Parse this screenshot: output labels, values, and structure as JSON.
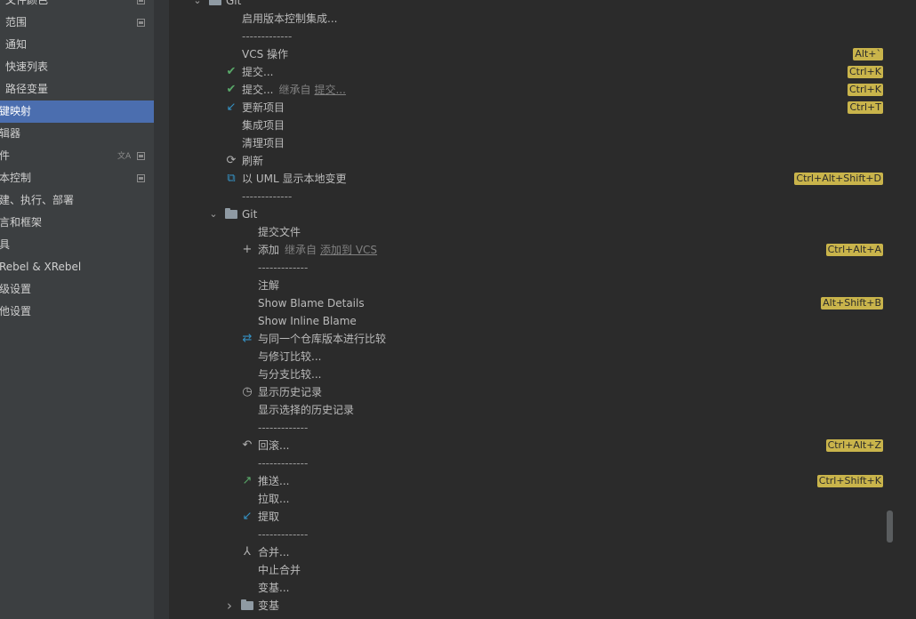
{
  "sidebar": {
    "items": [
      {
        "label": "文件颜色",
        "indent": 6,
        "settings_icon": true,
        "selected": false
      },
      {
        "label": "范围",
        "indent": 6,
        "settings_icon": true,
        "selected": false
      },
      {
        "label": "通知",
        "indent": 6,
        "settings_icon": false,
        "selected": false
      },
      {
        "label": "快速列表",
        "indent": 6,
        "settings_icon": false,
        "selected": false
      },
      {
        "label": "路径变量",
        "indent": 6,
        "settings_icon": false,
        "selected": false
      },
      {
        "label": "键映射",
        "indent": 0,
        "settings_icon": false,
        "selected": true
      },
      {
        "label": "辑器",
        "indent": 0,
        "settings_icon": false,
        "selected": false
      },
      {
        "label": "件",
        "indent": 0,
        "settings_icon": true,
        "translate_icon": true,
        "selected": false
      },
      {
        "label": "本控制",
        "indent": 0,
        "settings_icon": true,
        "selected": false
      },
      {
        "label": "建、执行、部署",
        "indent": 0,
        "settings_icon": false,
        "selected": false
      },
      {
        "label": "言和框架",
        "indent": 0,
        "settings_icon": false,
        "selected": false
      },
      {
        "label": "具",
        "indent": 0,
        "settings_icon": false,
        "selected": false
      },
      {
        "label": "Rebel & XRebel",
        "indent": 0,
        "settings_icon": false,
        "selected": false
      },
      {
        "label": "级设置",
        "indent": 0,
        "settings_icon": false,
        "selected": false
      },
      {
        "label": "他设置",
        "indent": 0,
        "settings_icon": false,
        "selected": false
      }
    ]
  },
  "keymap": {
    "rows": [
      {
        "type": "folder",
        "level": 0,
        "text": "Git",
        "expanded": true
      },
      {
        "type": "action",
        "level": 1,
        "text": "启用版本控制集成..."
      },
      {
        "type": "separator",
        "level": 1,
        "text": "-------------"
      },
      {
        "type": "action",
        "level": 1,
        "text": "VCS 操作",
        "shortcut": "Alt+`"
      },
      {
        "type": "action",
        "level": 1,
        "text": "提交...",
        "icon": "check-icon",
        "shortcut": "Ctrl+K"
      },
      {
        "type": "action",
        "level": 1,
        "text": "提交...",
        "icon": "check-icon",
        "inherit": "继承自",
        "inherit_link": "提交...",
        "shortcut": "Ctrl+K"
      },
      {
        "type": "action",
        "level": 1,
        "text": "更新项目",
        "icon": "update-arrow-icon",
        "shortcut": "Ctrl+T"
      },
      {
        "type": "action",
        "level": 1,
        "text": "集成项目"
      },
      {
        "type": "action",
        "level": 1,
        "text": "清理项目"
      },
      {
        "type": "action",
        "level": 1,
        "text": "刷新",
        "icon": "refresh-icon"
      },
      {
        "type": "action",
        "level": 1,
        "text": "以 UML 显示本地变更",
        "icon": "uml-diagram-icon",
        "shortcut": "Ctrl+Alt+Shift+D"
      },
      {
        "type": "separator",
        "level": 1,
        "text": "-------------"
      },
      {
        "type": "folder",
        "level": 1,
        "text": "Git",
        "expanded": true
      },
      {
        "type": "action",
        "level": 2,
        "text": "提交文件"
      },
      {
        "type": "action",
        "level": 2,
        "text": "添加",
        "icon": "plus-icon",
        "inherit": "继承自",
        "inherit_link": "添加到 VCS",
        "shortcut": "Ctrl+Alt+A"
      },
      {
        "type": "separator",
        "level": 2,
        "text": "-------------"
      },
      {
        "type": "action",
        "level": 2,
        "text": "注解"
      },
      {
        "type": "action",
        "level": 2,
        "text": "Show Blame Details",
        "shortcut": "Alt+Shift+B"
      },
      {
        "type": "action",
        "level": 2,
        "text": "Show Inline Blame"
      },
      {
        "type": "action",
        "level": 2,
        "text": "与同一个仓库版本进行比较",
        "icon": "compare-icon"
      },
      {
        "type": "action",
        "level": 2,
        "text": "与修订比较..."
      },
      {
        "type": "action",
        "level": 2,
        "text": "与分支比较..."
      },
      {
        "type": "action",
        "level": 2,
        "text": "显示历史记录",
        "icon": "clock-icon"
      },
      {
        "type": "action",
        "level": 2,
        "text": "显示选择的历史记录"
      },
      {
        "type": "separator",
        "level": 2,
        "text": "-------------"
      },
      {
        "type": "action",
        "level": 2,
        "text": "回滚...",
        "icon": "undo-icon",
        "shortcut": "Ctrl+Alt+Z"
      },
      {
        "type": "separator",
        "level": 2,
        "text": "-------------"
      },
      {
        "type": "action",
        "level": 2,
        "text": "推送...",
        "icon": "push-arrow-icon",
        "shortcut": "Ctrl+Shift+K"
      },
      {
        "type": "action",
        "level": 2,
        "text": "拉取..."
      },
      {
        "type": "action",
        "level": 2,
        "text": "提取",
        "icon": "fetch-arrow-icon"
      },
      {
        "type": "separator",
        "level": 2,
        "text": "-------------"
      },
      {
        "type": "action",
        "level": 2,
        "text": "合并...",
        "icon": "merge-icon"
      },
      {
        "type": "action",
        "level": 2,
        "text": "中止合并"
      },
      {
        "type": "action",
        "level": 2,
        "text": "变基..."
      },
      {
        "type": "folder",
        "level": 2,
        "text": "变基",
        "expanded": false
      }
    ]
  },
  "colors": {
    "selection": "#4b6eaf",
    "shortcut_badge": "#c9b44b",
    "check": "#59a869",
    "arrow_blue": "#3592c4"
  }
}
